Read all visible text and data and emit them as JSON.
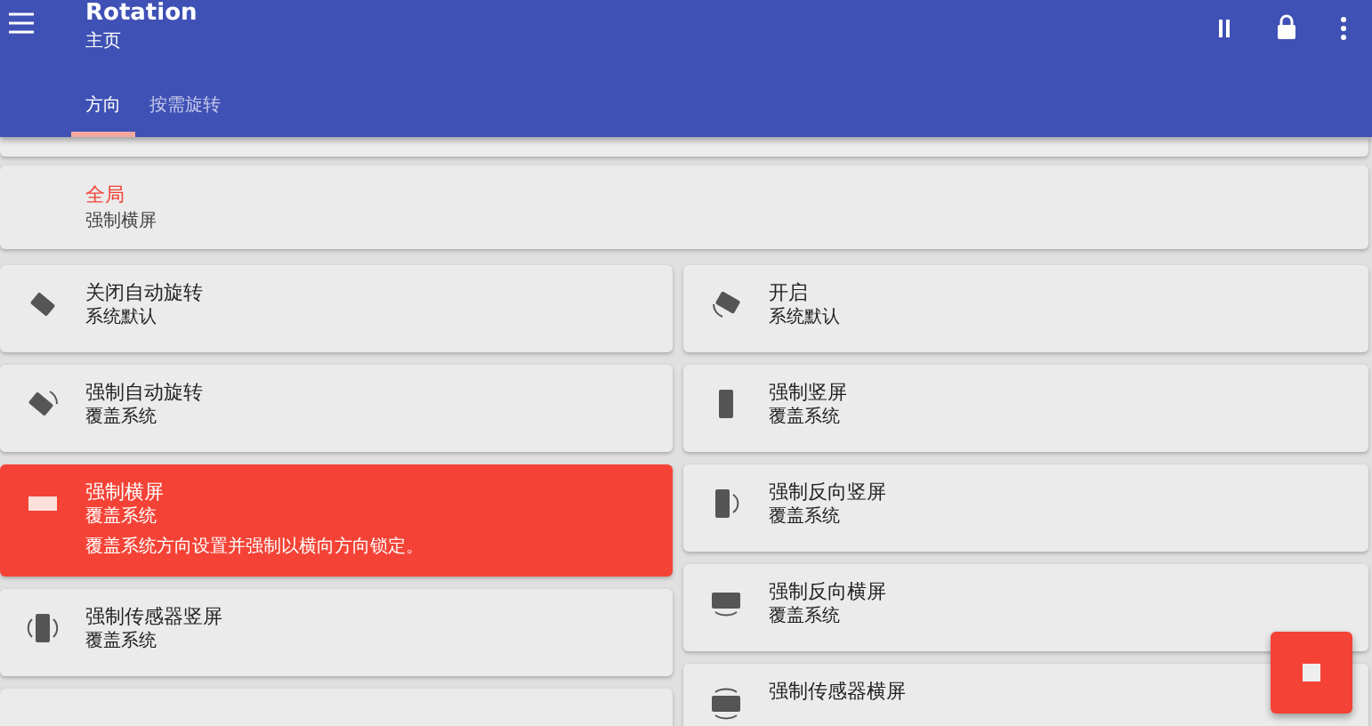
{
  "app_bar": {
    "title": "Rotation",
    "subtitle": "主页"
  },
  "tabs": [
    {
      "label": "方向",
      "selected": true
    },
    {
      "label": "按需旋转",
      "selected": false
    }
  ],
  "global": {
    "label": "全局",
    "value": "强制横屏"
  },
  "left": [
    {
      "kind": "diamond",
      "title": "关闭自动旋转",
      "subtitle": "系统默认",
      "selected": false
    },
    {
      "kind": "diamond-arc",
      "title": "强制自动旋转",
      "subtitle": "覆盖系统",
      "selected": false
    },
    {
      "kind": "landscape",
      "title": "强制横屏",
      "subtitle": "覆盖系统",
      "description": "覆盖系统方向设置并强制以横向方向锁定。",
      "selected": true
    },
    {
      "kind": "portrait-sensor",
      "title": "强制传感器竖屏",
      "subtitle": "覆盖系统",
      "selected": false
    },
    {
      "kind": "none",
      "selected": false
    }
  ],
  "right": [
    {
      "kind": "diamond-open",
      "title": "开启",
      "subtitle": "系统默认",
      "selected": false
    },
    {
      "kind": "portrait",
      "title": "强制竖屏",
      "subtitle": "覆盖系统",
      "selected": false
    },
    {
      "kind": "portrait-reverse",
      "title": "强制反向竖屏",
      "subtitle": "覆盖系统",
      "selected": false
    },
    {
      "kind": "landscape-reverse",
      "title": "强制反向横屏",
      "subtitle": "覆盖系统",
      "selected": false
    },
    {
      "kind": "landscape-sensor",
      "title": "强制传感器横屏",
      "selected": false
    }
  ]
}
